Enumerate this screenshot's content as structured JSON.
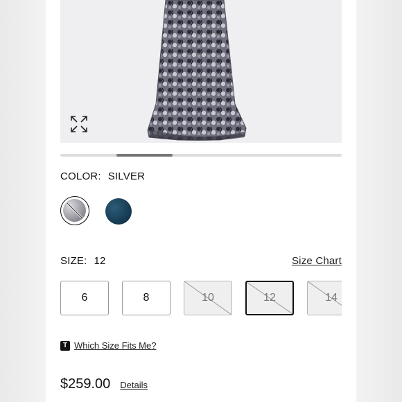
{
  "product": {
    "image_alt": "Silver sequin floral gown",
    "carousel": {
      "current_index": 2,
      "total_slides": 5
    }
  },
  "color": {
    "label": "COLOR:",
    "selected": "SILVER",
    "options": [
      {
        "name": "Silver",
        "hex": "#9a9aa3"
      },
      {
        "name": "Navy",
        "hex": "#163a52"
      }
    ]
  },
  "size": {
    "label": "SIZE:",
    "selected": "12",
    "size_chart_label": "Size Chart",
    "options": [
      {
        "label": "6",
        "available": true
      },
      {
        "label": "8",
        "available": true
      },
      {
        "label": "10",
        "available": false
      },
      {
        "label": "12",
        "available": false,
        "selected": true
      },
      {
        "label": "14",
        "available": false
      }
    ]
  },
  "fit": {
    "icon": "T",
    "link_label": "Which Size Fits Me?"
  },
  "pricing": {
    "price": "$259.00",
    "details_label": "Details"
  }
}
